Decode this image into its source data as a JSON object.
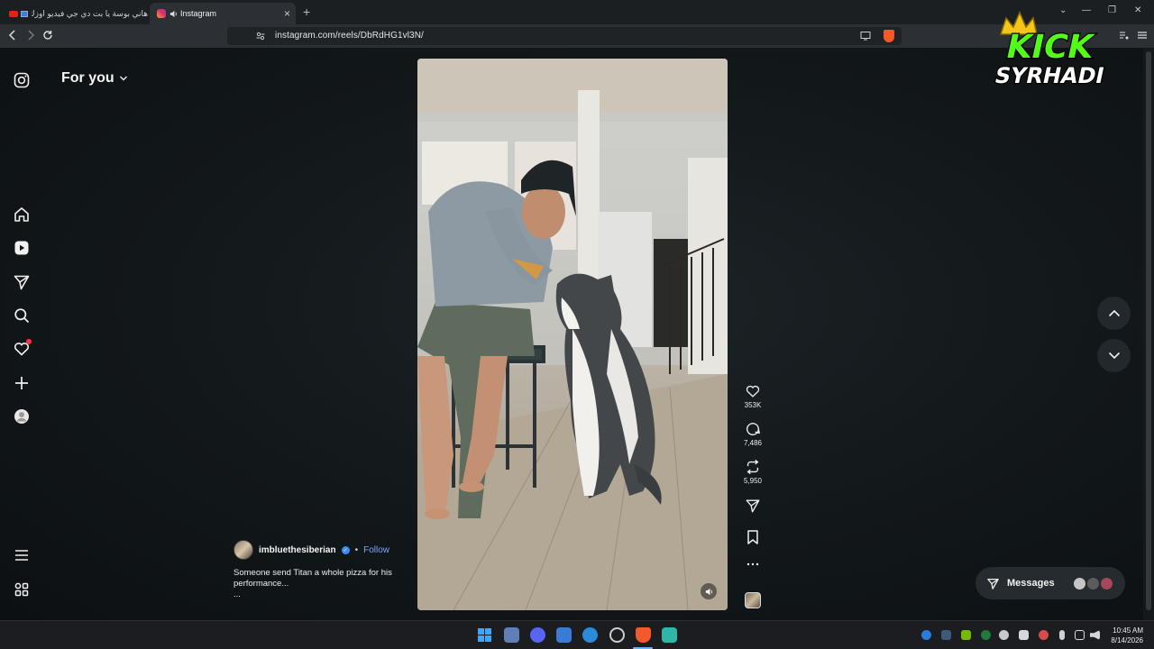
{
  "browser": {
    "tabs": [
      {
        "label": "هاني بوسة يا بت دي جي فيديو اوزك"
      },
      {
        "label": "Instagram"
      }
    ],
    "url": "instagram.com/reels/DbRdHG1vl3N/"
  },
  "feed": {
    "title": "For you"
  },
  "reel": {
    "author": "imbluethesiberian",
    "follow_label": "Follow",
    "separator": "•",
    "caption": "Someone send Titan a whole pizza for his performance...",
    "more": "...",
    "likes": "353K",
    "comments": "7,486",
    "reposts": "5,950"
  },
  "messages": {
    "label": "Messages"
  },
  "overlay": {
    "logo_line1": "KICK",
    "logo_line2": "SYRHADI"
  },
  "clock": {
    "time": "10:45 AM",
    "date": "8/14/2026"
  }
}
